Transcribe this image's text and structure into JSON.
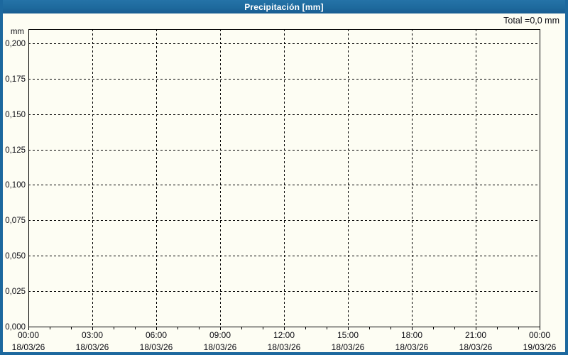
{
  "window": {
    "title": "Precipitación [mm]"
  },
  "summary": {
    "total_label": "Total =0,0 mm"
  },
  "colors": {
    "titlebar": "#1e6a9d",
    "border": "#1c689e",
    "background": "#fdfdf3",
    "grid": "#000000",
    "text": "#0d0d14",
    "title_text": "#ffffff"
  },
  "chart_data": {
    "type": "line",
    "title": "Precipitación [mm]",
    "ylabel": "mm",
    "xlabel": "",
    "total_annotation": "Total =0,0 mm",
    "grid": "dashed",
    "legend": "none",
    "ylim": [
      0,
      0.21
    ],
    "y_tick_values": [
      0,
      0.025,
      0.05,
      0.075,
      0.1,
      0.125,
      0.15,
      0.175,
      0.2
    ],
    "y_tick_labels": [
      "0,000",
      "0,025",
      "0,050",
      "0,075",
      "0,100",
      "0,125",
      "0,150",
      "0,175",
      "0,200"
    ],
    "x_ticks": [
      {
        "time": "00:00",
        "date": "18/03/26"
      },
      {
        "time": "03:00",
        "date": "18/03/26"
      },
      {
        "time": "06:00",
        "date": "18/03/26"
      },
      {
        "time": "09:00",
        "date": "18/03/26"
      },
      {
        "time": "12:00",
        "date": "18/03/26"
      },
      {
        "time": "15:00",
        "date": "18/03/26"
      },
      {
        "time": "18:00",
        "date": "18/03/26"
      },
      {
        "time": "21:00",
        "date": "18/03/26"
      },
      {
        "time": "00:00",
        "date": "19/03/26"
      }
    ],
    "x_minor_ticks_per_interval": 3,
    "series": [
      {
        "name": "Precipitación",
        "values": []
      }
    ]
  }
}
